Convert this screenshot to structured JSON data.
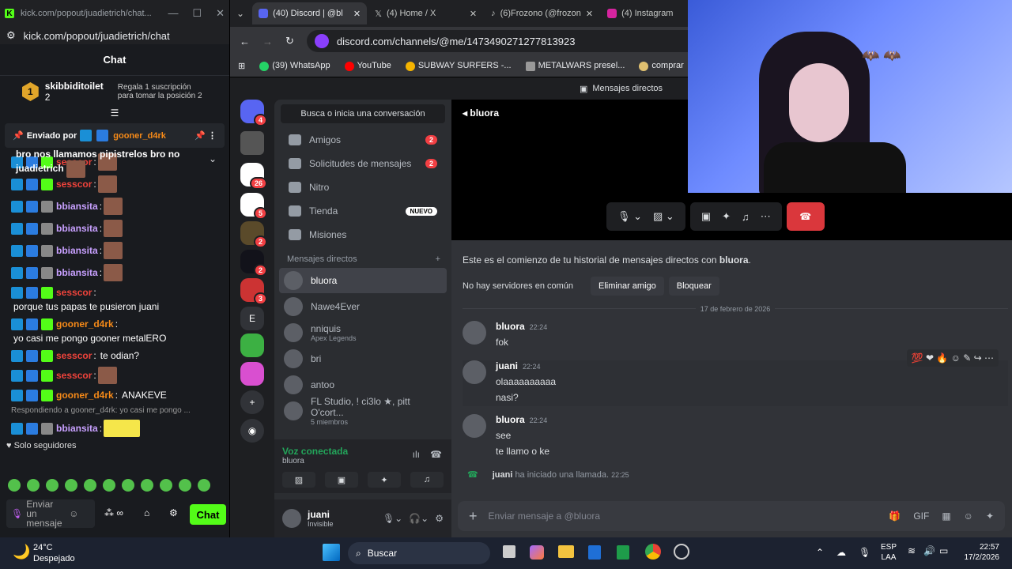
{
  "kick": {
    "tab_title": "kick.com/popout/juadietrich/chat...",
    "url": "kick.com/popout/juadietrich/chat",
    "header": "Chat",
    "top_sub_user": "skibbiditoilet",
    "top_sub_count": "2",
    "top_sub_rank": "1",
    "gift_text": "Regala 1 suscripción para tomar la posición 2",
    "pinned_by": "Enviado por",
    "pinned_user": "gooner_d4rk",
    "pinned_msg": "bro nos llamamos pipistrelos bro no juadietrich",
    "lines": [
      {
        "user": "sesscor",
        "cls": "ur",
        "text": ""
      },
      {
        "user": "sesscor",
        "cls": "ur",
        "text": ""
      },
      {
        "user": "bbiansita",
        "cls": "up",
        "text": ""
      },
      {
        "user": "bbiansita",
        "cls": "up",
        "text": ""
      },
      {
        "user": "bbiansita",
        "cls": "up",
        "text": ""
      },
      {
        "user": "bbiansita",
        "cls": "up",
        "text": ""
      },
      {
        "user": "sesscor",
        "cls": "ur",
        "text": "porque tus papas te pusieron juani"
      },
      {
        "user": "gooner_d4rk",
        "cls": "uo",
        "text": "yo casi me pongo gooner metalERO"
      },
      {
        "user": "sesscor",
        "cls": "ur",
        "text": "te odian?"
      },
      {
        "user": "sesscor",
        "cls": "ur",
        "text": ""
      },
      {
        "user": "gooner_d4rk",
        "cls": "uo",
        "text": "ANAKEVE"
      }
    ],
    "reply_note": "Respondiendo a gooner_d4rk: yo casi me pongo ...",
    "last_user": "bbiansita",
    "followers_only": "Solo seguidores",
    "input_placeholder": "Enviar un mensaje",
    "chat_button": "Chat"
  },
  "browser": {
    "tabs": [
      {
        "label": "(40) Discord | @bl"
      },
      {
        "label": "(4) Home / X"
      },
      {
        "label": "(6)Frozono (@frozon"
      },
      {
        "label": "(4) Instagram"
      }
    ],
    "url": "discord.com/channels/@me/1473490271277813923",
    "bookmarks": [
      "(39) WhatsApp",
      "YouTube",
      "SUBWAY SURFERS -...",
      "METALWARS presel...",
      "comprar",
      "outr"
    ],
    "bookmark_colors": [
      "#25d366",
      "#ff0000",
      "#f5b400",
      "#999999",
      "#e0c070",
      "#ff0000"
    ]
  },
  "discord": {
    "top_label": "Mensajes directos",
    "search": "Busca o inicia una conversación",
    "nav": [
      {
        "label": "Amigos",
        "count": "2"
      },
      {
        "label": "Solicitudes de mensajes",
        "count": "2"
      },
      {
        "label": "Nitro",
        "count": ""
      },
      {
        "label": "Tienda",
        "tag": "NUEVO"
      },
      {
        "label": "Misiones",
        "count": ""
      }
    ],
    "guild_badges": [
      "4",
      "26",
      "5",
      "2",
      "2",
      "3"
    ],
    "dm_header": "Mensajes directos",
    "dms": [
      {
        "name": "bluora",
        "sub": ""
      },
      {
        "name": "Nawe4Ever",
        "sub": ""
      },
      {
        "name": "nniquis",
        "sub": "Apex Legends"
      },
      {
        "name": "bri",
        "sub": ""
      },
      {
        "name": "antoo",
        "sub": ""
      },
      {
        "name": "FL Studio, ! ci3lo ★, pitt O'cort...",
        "sub": "5 miembros"
      }
    ],
    "voice_status": "Voz conectada",
    "voice_user": "bluora",
    "me_name": "juani",
    "me_status": "Invisible",
    "channel_name": "bluora",
    "history_start": "Este es el comienzo de tu historial de mensajes directos con",
    "history_user": "bluora",
    "no_servers": "No hay servidores en común",
    "remove_friend": "Eliminar amigo",
    "block": "Bloquear",
    "date_divider": "17 de febrero de 2026",
    "messages": [
      {
        "user": "bluora",
        "time": "22:24",
        "lines": [
          "fok"
        ]
      },
      {
        "user": "juani",
        "time": "22:24",
        "lines": [
          "olaaaaaaaaaa",
          "nasi?"
        ]
      },
      {
        "user": "bluora",
        "time": "22:24",
        "lines": [
          "see",
          "te llamo o ke"
        ]
      }
    ],
    "call_user": "juani",
    "call_text": "ha iniciado una llamada.",
    "call_time": "22:25",
    "composer_placeholder": "Enviar mensaje a @bluora"
  },
  "taskbar": {
    "temp": "24°C",
    "weather": "Despejado",
    "search": "Buscar",
    "lang1": "ESP",
    "lang2": "LAA",
    "time": "22:57",
    "date": "17/2/2026"
  }
}
